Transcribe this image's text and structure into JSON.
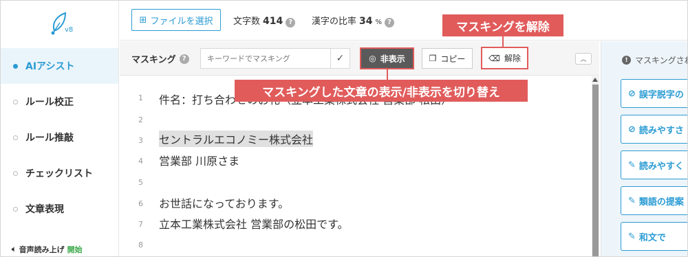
{
  "app": {
    "logo_version": "v8"
  },
  "sidebar": {
    "items": [
      {
        "label": "AIアシスト",
        "active": true
      },
      {
        "label": "ルール校正",
        "active": false
      },
      {
        "label": "ルール推敲",
        "active": false
      },
      {
        "label": "チェックリスト",
        "active": false
      },
      {
        "label": "文章表現",
        "active": false
      }
    ],
    "audio": {
      "label": "音声読み上げ",
      "action": "開始"
    }
  },
  "topbar": {
    "file_button": "ファイルを選択",
    "char_count_label": "文字数",
    "char_count_value": "414",
    "kanji_ratio_label": "漢字の比率",
    "kanji_ratio_value": "34",
    "kanji_ratio_unit": "%"
  },
  "masking": {
    "label": "マスキング",
    "input_placeholder": "キーワードでマスキング",
    "hide_button": "非表示",
    "copy_button": "コピー",
    "unmask_button": "解除"
  },
  "editor": {
    "lines": [
      {
        "no": "1",
        "text": "件名：打ち合わせのお礼（立本工業株式会社 営業部 松田）"
      },
      {
        "no": "2",
        "text": ""
      },
      {
        "no": "3",
        "text": "セントラルエコノミー株式会社"
      },
      {
        "no": "4",
        "text": "営業部 川原さま"
      },
      {
        "no": "5",
        "text": ""
      },
      {
        "no": "6",
        "text": "お世話になっております。"
      },
      {
        "no": "7",
        "text": "立本工業株式会社 営業部の松田です。"
      },
      {
        "no": "8",
        "text": ""
      }
    ]
  },
  "right_panel": {
    "heading": "マスキングされた",
    "cards": [
      {
        "icon": "check-circle-icon",
        "label": "誤字脱字の"
      },
      {
        "icon": "check-circle-icon",
        "label": "読みやすさ"
      },
      {
        "icon": "pencil-icon",
        "label": "読みやすく"
      },
      {
        "icon": "pencil-icon",
        "label": "類語の提案"
      },
      {
        "icon": "pencil-icon",
        "label": "和文で"
      }
    ]
  },
  "callouts": {
    "unmask": "マスキングを解除",
    "toggle": "マスキングした文章の表示/非表示を切り替え"
  },
  "colors": {
    "accent": "#2a9bd3",
    "callout": "#e15b5b",
    "highlight": "#e0e0e0"
  }
}
